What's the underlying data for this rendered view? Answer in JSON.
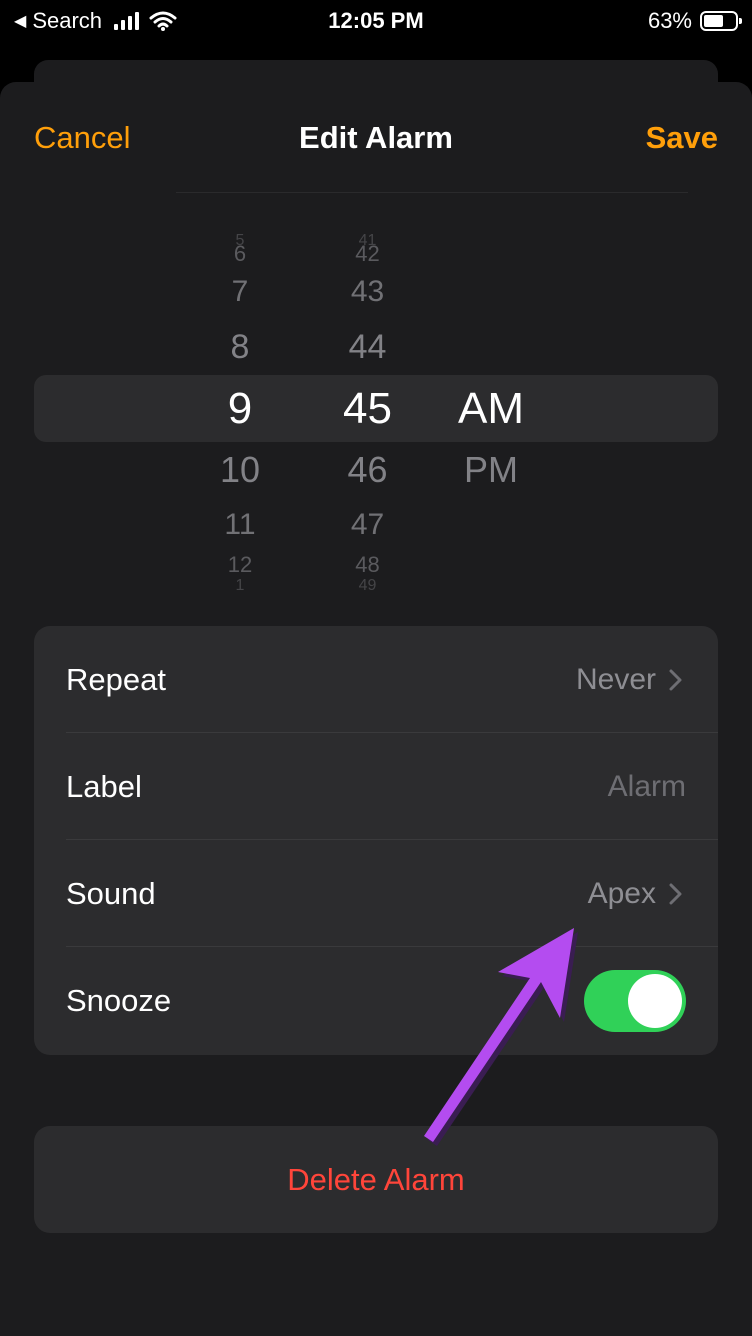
{
  "status_bar": {
    "back_label": "Search",
    "time": "12:05 PM",
    "battery": "63%",
    "battery_level": 0.63
  },
  "nav": {
    "cancel": "Cancel",
    "title": "Edit Alarm",
    "save": "Save",
    "accent_color": "#ff9f0a"
  },
  "picker": {
    "hours": [
      "5",
      "6",
      "7",
      "8",
      "9",
      "10",
      "11",
      "12",
      "1"
    ],
    "minutes": [
      "41",
      "42",
      "43",
      "44",
      "45",
      "46",
      "47",
      "48",
      "49"
    ],
    "periods": [
      "AM",
      "PM"
    ],
    "selected": {
      "hour": "9",
      "minute": "45",
      "period": "AM"
    }
  },
  "settings": {
    "repeat": {
      "label": "Repeat",
      "value": "Never"
    },
    "label": {
      "label": "Label",
      "value": "Alarm"
    },
    "sound": {
      "label": "Sound",
      "value": "Apex"
    },
    "snooze": {
      "label": "Snooze",
      "on": true
    }
  },
  "delete": {
    "label": "Delete Alarm",
    "color": "#ff453a"
  },
  "annotation": {
    "arrow_color": "#b44cf0"
  }
}
